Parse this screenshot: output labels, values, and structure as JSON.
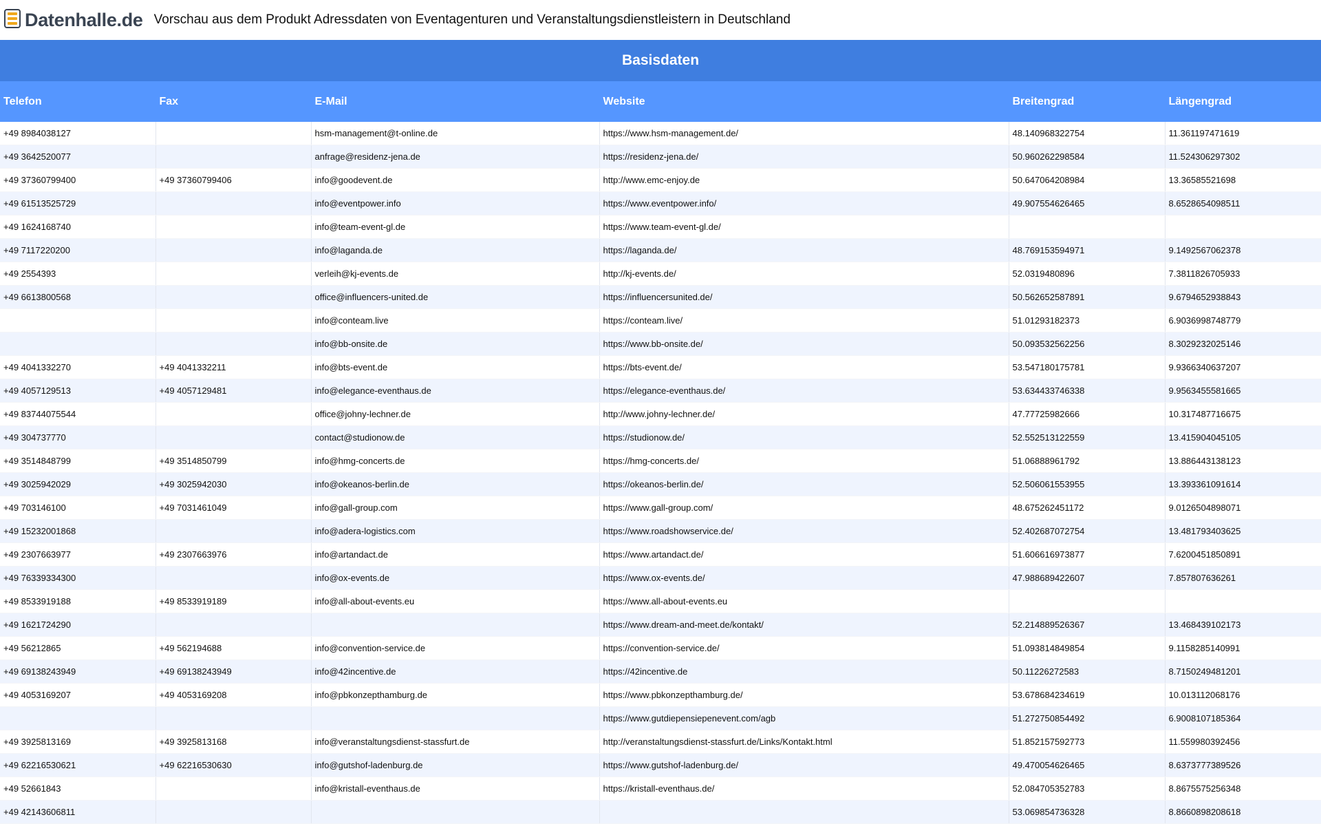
{
  "header": {
    "logo_text": "Datenhalle.de",
    "title": "Vorschau aus dem Produkt Adressdaten von Eventagenturen und Veranstaltungsdienstleistern in Deutschland"
  },
  "table": {
    "section_title": "Basisdaten",
    "columns": [
      "Telefon",
      "Fax",
      "E-Mail",
      "Website",
      "Breitengrad",
      "Längengrad"
    ],
    "rows": [
      [
        "+49 8984038127",
        "",
        "hsm-management@t-online.de",
        "https://www.hsm-management.de/",
        "48.140968322754",
        "11.361197471619"
      ],
      [
        "+49 3642520077",
        "",
        "anfrage@residenz-jena.de",
        "https://residenz-jena.de/",
        "50.960262298584",
        "11.524306297302"
      ],
      [
        "+49 37360799400",
        "+49 37360799406",
        "info@goodevent.de",
        "http://www.emc-enjoy.de",
        "50.647064208984",
        "13.36585521698"
      ],
      [
        "+49 61513525729",
        "",
        "info@eventpower.info",
        "https://www.eventpower.info/",
        "49.907554626465",
        "8.6528654098511"
      ],
      [
        "+49 1624168740",
        "",
        "info@team-event-gl.de",
        "https://www.team-event-gl.de/",
        "",
        ""
      ],
      [
        "+49 7117220200",
        "",
        "info@laganda.de",
        "https://laganda.de/",
        "48.769153594971",
        "9.1492567062378"
      ],
      [
        "+49 2554393",
        "",
        "verleih@kj-events.de",
        "http://kj-events.de/",
        "52.0319480896",
        "7.3811826705933"
      ],
      [
        "+49 6613800568",
        "",
        "office@influencers-united.de",
        "https://influencersunited.de/",
        "50.562652587891",
        "9.6794652938843"
      ],
      [
        "",
        "",
        "info@conteam.live",
        "https://conteam.live/",
        "51.01293182373",
        "6.9036998748779"
      ],
      [
        "",
        "",
        "info@bb-onsite.de",
        "https://www.bb-onsite.de/",
        "50.093532562256",
        "8.3029232025146"
      ],
      [
        "+49 4041332270",
        "+49 4041332211",
        "info@bts-event.de",
        "https://bts-event.de/",
        "53.547180175781",
        "9.9366340637207"
      ],
      [
        "+49 4057129513",
        "+49 4057129481",
        "info@elegance-eventhaus.de",
        "https://elegance-eventhaus.de/",
        "53.634433746338",
        "9.9563455581665"
      ],
      [
        "+49 83744075544",
        "",
        "office@johny-lechner.de",
        "http://www.johny-lechner.de/",
        "47.77725982666",
        "10.317487716675"
      ],
      [
        "+49 304737770",
        "",
        "contact@studionow.de",
        "https://studionow.de/",
        "52.552513122559",
        "13.415904045105"
      ],
      [
        "+49 3514848799",
        "+49 3514850799",
        "info@hmg-concerts.de",
        "https://hmg-concerts.de/",
        "51.06888961792",
        "13.886443138123"
      ],
      [
        "+49 3025942029",
        "+49 3025942030",
        "info@okeanos-berlin.de",
        "https://okeanos-berlin.de/",
        "52.506061553955",
        "13.393361091614"
      ],
      [
        "+49 703146100",
        "+49 7031461049",
        "info@gall-group.com",
        "https://www.gall-group.com/",
        "48.675262451172",
        "9.0126504898071"
      ],
      [
        "+49 15232001868",
        "",
        "info@adera-logistics.com",
        "https://www.roadshowservice.de/",
        "52.402687072754",
        "13.481793403625"
      ],
      [
        "+49 2307663977",
        "+49 2307663976",
        "info@artandact.de",
        "https://www.artandact.de/",
        "51.606616973877",
        "7.6200451850891"
      ],
      [
        "+49 76339334300",
        "",
        "info@ox-events.de",
        "https://www.ox-events.de/",
        "47.988689422607",
        "7.857807636261"
      ],
      [
        "+49 8533919188",
        "+49 8533919189",
        "info@all-about-events.eu",
        "https://www.all-about-events.eu",
        "",
        ""
      ],
      [
        "+49 1621724290",
        "",
        "",
        "https://www.dream-and-meet.de/kontakt/",
        "52.214889526367",
        "13.468439102173"
      ],
      [
        "+49 56212865",
        "+49 562194688",
        "info@convention-service.de",
        "https://convention-service.de/",
        "51.093814849854",
        "9.1158285140991"
      ],
      [
        "+49 69138243949",
        "+49 69138243949",
        "info@42incentive.de",
        "https://42incentive.de",
        "50.11226272583",
        "8.7150249481201"
      ],
      [
        "+49 4053169207",
        "+49 4053169208",
        "info@pbkonzepthamburg.de",
        "https://www.pbkonzepthamburg.de/",
        "53.678684234619",
        "10.013112068176"
      ],
      [
        "",
        "",
        "",
        "https://www.gutdiepensiepenevent.com/agb",
        "51.272750854492",
        "6.9008107185364"
      ],
      [
        "+49 3925813169",
        "+49 3925813168",
        "info@veranstaltungsdienst-stassfurt.de",
        "http://veranstaltungsdienst-stassfurt.de/Links/Kontakt.html",
        "51.852157592773",
        "11.559980392456"
      ],
      [
        "+49 62216530621",
        "+49 62216530630",
        "info@gutshof-ladenburg.de",
        "https://www.gutshof-ladenburg.de/",
        "49.470054626465",
        "8.6373777389526"
      ],
      [
        "+49 52661843",
        "",
        "info@kristall-eventhaus.de",
        "https://kristall-eventhaus.de/",
        "52.084705352783",
        "8.8675575256348"
      ],
      [
        "+49 42143606811",
        "",
        "",
        "",
        "53.069854736328",
        "8.8660898208618"
      ]
    ]
  }
}
